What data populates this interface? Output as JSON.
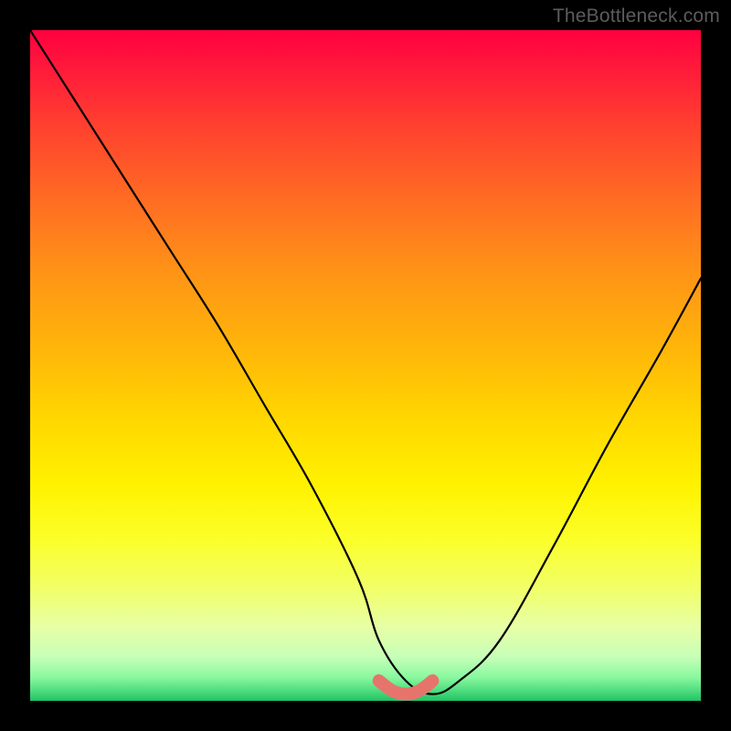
{
  "watermark": "TheBottleneck.com",
  "chart_data": {
    "type": "line",
    "title": "",
    "xlabel": "",
    "ylabel": "",
    "xlim": [
      0,
      100
    ],
    "ylim": [
      0,
      100
    ],
    "series": [
      {
        "name": "bottleneck-curve",
        "x": [
          0,
          7,
          14,
          21,
          28,
          35,
          42,
          49,
          52,
          56,
          60,
          64,
          70,
          78,
          86,
          94,
          100
        ],
        "values": [
          100,
          89,
          78,
          67,
          56,
          44,
          32,
          18,
          9,
          3,
          1,
          3,
          9,
          23,
          38,
          52,
          63
        ]
      }
    ],
    "highlight": {
      "name": "optimal-range",
      "x": [
        52,
        54,
        56,
        58,
        60
      ],
      "values": [
        3,
        1.5,
        1,
        1.5,
        3
      ],
      "color": "#e6746c"
    }
  }
}
